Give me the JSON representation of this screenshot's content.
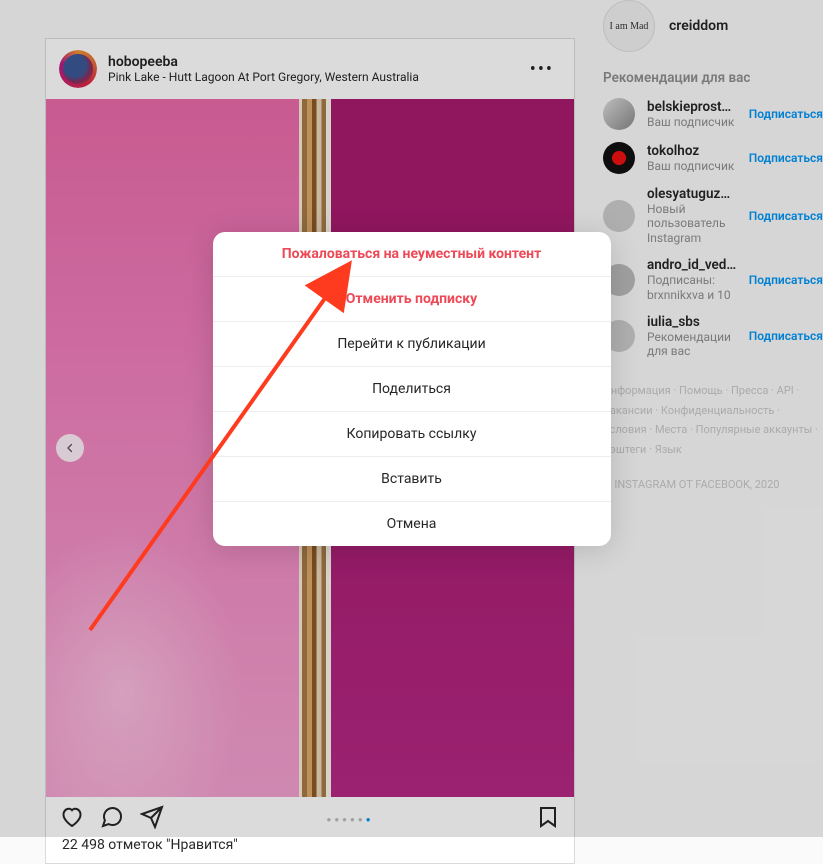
{
  "post": {
    "username": "hobopeeba",
    "location": "Pink Lake - Hutt Lagoon At Port Gregory, Western Australia",
    "likes_line": "22 498 отметок \"Нравится\"",
    "more_glyph": "•••"
  },
  "carousel": {
    "total": 6,
    "active": 6
  },
  "profile": {
    "username": "creiddom",
    "avatar_text": "I am Mad"
  },
  "recommendations": {
    "title": "Рекомендации для вас",
    "action_label": "Подписаться",
    "items": [
      {
        "name": "belskieprostory",
        "sub": "Ваш подписчик"
      },
      {
        "name": "tokolhoz",
        "sub": "Ваш подписчик"
      },
      {
        "name": "olesyatuguzbaeva",
        "sub": "Новый пользователь Instagram"
      },
      {
        "name": "andro_id_vedro_id",
        "sub": "Подписаны: brxnnikxva и 10"
      },
      {
        "name": "iulia_sbs",
        "sub": "Рекомендации для вас"
      }
    ]
  },
  "footer": {
    "links": "Информация · Помощь · Пресса · API · Вакансии · Конфиденциальность · Условия · Места · Популярные аккаунты · Хэштеги · Язык",
    "copy": "© INSTAGRAM ОТ FACEBOOK, 2020"
  },
  "dialog": {
    "report": "Пожаловаться на неуместный контент",
    "unfollow": "Отменить подписку",
    "go_to_post": "Перейти к публикации",
    "share": "Поделиться",
    "copy_link": "Копировать ссылку",
    "embed": "Вставить",
    "cancel": "Отмена"
  },
  "annotation": {
    "color": "#ff3b1f"
  }
}
